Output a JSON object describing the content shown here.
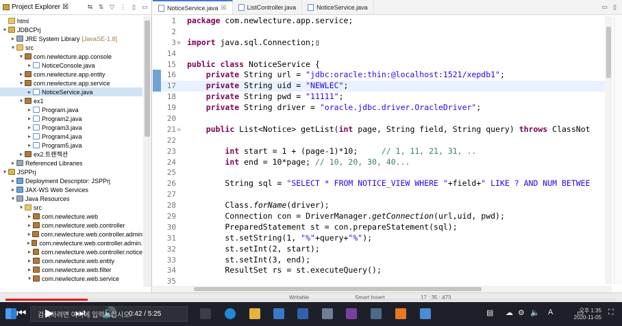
{
  "project_explorer": {
    "title": "Project Explorer",
    "close_glyph": "☒",
    "tools": [
      "⇆",
      "⇅",
      "▽",
      "⋮",
      "▯",
      "▭"
    ],
    "tree": [
      {
        "indent": 0,
        "twisty": "",
        "icon": "folder",
        "label": "html",
        "selected": false
      },
      {
        "indent": 0,
        "twisty": "▾",
        "icon": "project",
        "label": "JDBCPrj",
        "selected": false
      },
      {
        "indent": 1,
        "twisty": "▸",
        "icon": "lib",
        "label": "JRE System Library",
        "suffix": "[JavaSE-1.8]",
        "selected": false
      },
      {
        "indent": 1,
        "twisty": "▾",
        "icon": "folder",
        "label": "src",
        "selected": false
      },
      {
        "indent": 2,
        "twisty": "▾",
        "icon": "package",
        "label": "com.newlecture.app.console",
        "selected": false
      },
      {
        "indent": 3,
        "twisty": "▸",
        "icon": "java",
        "label": "NoticeConsole.java",
        "selected": false
      },
      {
        "indent": 2,
        "twisty": "▸",
        "icon": "package",
        "label": "com.newlecture.app.entity",
        "selected": false
      },
      {
        "indent": 2,
        "twisty": "▾",
        "icon": "package",
        "label": "com.newlecture.app.service",
        "selected": false
      },
      {
        "indent": 3,
        "twisty": "▸",
        "icon": "java",
        "label": "NoticeService.java",
        "selected": true
      },
      {
        "indent": 2,
        "twisty": "▾",
        "icon": "package",
        "label": "ex1",
        "selected": false
      },
      {
        "indent": 3,
        "twisty": "▸",
        "icon": "java",
        "label": "Program.java",
        "selected": false
      },
      {
        "indent": 3,
        "twisty": "▸",
        "icon": "java",
        "label": "Program2.java",
        "selected": false
      },
      {
        "indent": 3,
        "twisty": "▸",
        "icon": "java",
        "label": "Program3.java",
        "selected": false
      },
      {
        "indent": 3,
        "twisty": "▸",
        "icon": "java",
        "label": "Program4.java",
        "selected": false
      },
      {
        "indent": 3,
        "twisty": "▸",
        "icon": "java",
        "label": "Program5.java",
        "selected": false
      },
      {
        "indent": 2,
        "twisty": "▸",
        "icon": "package",
        "label": "ex2.트랜젝션",
        "selected": false
      },
      {
        "indent": 1,
        "twisty": "▸",
        "icon": "lib",
        "label": "Referenced Libraries",
        "selected": false
      },
      {
        "indent": 0,
        "twisty": "▾",
        "icon": "project",
        "label": "JSPPrj",
        "selected": false
      },
      {
        "indent": 1,
        "twisty": "▸",
        "icon": "web",
        "label": "Deployment Descriptor: JSPPrj",
        "selected": false
      },
      {
        "indent": 1,
        "twisty": "▸",
        "icon": "web",
        "label": "JAX-WS Web Services",
        "selected": false
      },
      {
        "indent": 1,
        "twisty": "▾",
        "icon": "lib",
        "label": "Java Resources",
        "selected": false
      },
      {
        "indent": 2,
        "twisty": "▾",
        "icon": "folder",
        "label": "src",
        "selected": false
      },
      {
        "indent": 3,
        "twisty": "▸",
        "icon": "package",
        "label": "com.newlecture.web",
        "selected": false
      },
      {
        "indent": 3,
        "twisty": "▸",
        "icon": "package",
        "label": "com.newlecture.web.controller",
        "selected": false
      },
      {
        "indent": 3,
        "twisty": "▸",
        "icon": "package",
        "label": "com.newlecture.web.controller.admin",
        "selected": false
      },
      {
        "indent": 3,
        "twisty": "▸",
        "icon": "package",
        "label": "com.newlecture.web.controller.admin.",
        "selected": false
      },
      {
        "indent": 3,
        "twisty": "▸",
        "icon": "package",
        "label": "com.newlecture.web.controller.notice",
        "selected": false
      },
      {
        "indent": 3,
        "twisty": "▸",
        "icon": "package",
        "label": "com.newlecture.web.entity",
        "selected": false
      },
      {
        "indent": 3,
        "twisty": "▸",
        "icon": "package",
        "label": "com.newlecture.web.filter",
        "selected": false
      },
      {
        "indent": 3,
        "twisty": "▾",
        "icon": "package",
        "label": "com.newlecture.web.service",
        "selected": false
      }
    ]
  },
  "editor": {
    "tabs": [
      {
        "label": "NoticeService.java",
        "close": "☒",
        "active": true
      },
      {
        "label": "ListController.java",
        "close": "",
        "active": false
      },
      {
        "label": "NoticeService.java",
        "close": "",
        "active": false
      }
    ],
    "tab_controls": [
      "▭",
      "▯"
    ],
    "lines": [
      {
        "no": "1",
        "fold": "",
        "current": false,
        "marker": false,
        "tokens": [
          [
            "kw",
            "package"
          ],
          [
            "",
            "com.newlecture.app.service;"
          ]
        ]
      },
      {
        "no": "2",
        "fold": "",
        "current": false,
        "marker": false,
        "tokens": []
      },
      {
        "no": "3",
        "fold": "⊕",
        "current": false,
        "marker": false,
        "tokens": [
          [
            "kw",
            "import"
          ],
          [
            "",
            "java.sql.Connection;"
          ],
          [
            "",
            "▯"
          ]
        ]
      },
      {
        "no": "14",
        "fold": "",
        "current": false,
        "marker": false,
        "tokens": []
      },
      {
        "no": "15",
        "fold": "",
        "current": false,
        "marker": false,
        "tokens": [
          [
            "kw",
            "public class"
          ],
          [
            "",
            " NoticeService {"
          ]
        ]
      },
      {
        "no": "16",
        "fold": "",
        "current": false,
        "marker": true,
        "tokens": [
          [
            "",
            "    "
          ],
          [
            "kw",
            "private"
          ],
          [
            "",
            " String url = "
          ],
          [
            "str",
            "\"jdbc:oracle:thin:@localhost:1521/xepdb1\""
          ],
          [
            "",
            ";"
          ]
        ]
      },
      {
        "no": "17",
        "fold": "",
        "current": true,
        "marker": true,
        "tokens": [
          [
            "",
            "    "
          ],
          [
            "kw",
            "private"
          ],
          [
            "",
            " String uid = "
          ],
          [
            "str",
            "\"NEWLEC\""
          ],
          [
            "",
            ";"
          ]
        ]
      },
      {
        "no": "18",
        "fold": "",
        "current": false,
        "marker": false,
        "tokens": [
          [
            "",
            "    "
          ],
          [
            "kw",
            "private"
          ],
          [
            "",
            " String pwd = "
          ],
          [
            "str",
            "\"11111\""
          ],
          [
            "",
            ";"
          ]
        ]
      },
      {
        "no": "19",
        "fold": "",
        "current": false,
        "marker": false,
        "tokens": [
          [
            "",
            "    "
          ],
          [
            "kw",
            "private"
          ],
          [
            "",
            " String driver = "
          ],
          [
            "str",
            "\"oracle.jdbc.driver.OracleDriver\""
          ],
          [
            "",
            ";"
          ]
        ]
      },
      {
        "no": "20",
        "fold": "",
        "current": false,
        "marker": false,
        "tokens": []
      },
      {
        "no": "21",
        "fold": "⊖",
        "current": false,
        "marker": false,
        "tokens": [
          [
            "",
            "    "
          ],
          [
            "kw",
            "public"
          ],
          [
            "",
            " List<Notice> getList("
          ],
          [
            "kw",
            "int"
          ],
          [
            "",
            " page, String field, String query) "
          ],
          [
            "kw",
            "throws"
          ],
          [
            "",
            " ClassNot"
          ]
        ]
      },
      {
        "no": "22",
        "fold": "",
        "current": false,
        "marker": false,
        "tokens": []
      },
      {
        "no": "23",
        "fold": "",
        "current": false,
        "marker": false,
        "tokens": [
          [
            "",
            "        "
          ],
          [
            "kw",
            "int"
          ],
          [
            "",
            " start = 1 + (page-1)*10;     "
          ],
          [
            "cmt",
            "// 1, 11, 21, 31, .."
          ]
        ]
      },
      {
        "no": "24",
        "fold": "",
        "current": false,
        "marker": false,
        "tokens": [
          [
            "",
            "        "
          ],
          [
            "kw",
            "int"
          ],
          [
            "",
            " end = 10*page; "
          ],
          [
            "cmt",
            "// 10, 20, 30, 40..."
          ]
        ]
      },
      {
        "no": "25",
        "fold": "",
        "current": false,
        "marker": false,
        "tokens": []
      },
      {
        "no": "26",
        "fold": "",
        "current": false,
        "marker": false,
        "tokens": [
          [
            "",
            "        String sql = "
          ],
          [
            "str",
            "\"SELECT * FROM NOTICE_VIEW WHERE \""
          ],
          [
            "",
            "+field+"
          ],
          [
            "str",
            "\" LIKE ? AND NUM BETWEE"
          ]
        ]
      },
      {
        "no": "27",
        "fold": "",
        "current": false,
        "marker": false,
        "tokens": []
      },
      {
        "no": "28",
        "fold": "",
        "current": false,
        "marker": false,
        "tokens": [
          [
            "",
            "        Class."
          ],
          [
            "it",
            "forName"
          ],
          [
            "",
            "(driver);"
          ]
        ]
      },
      {
        "no": "29",
        "fold": "",
        "current": false,
        "marker": false,
        "tokens": [
          [
            "",
            "        Connection con = DriverManager."
          ],
          [
            "it",
            "getConnection"
          ],
          [
            "",
            "(url,uid, pwd);"
          ]
        ]
      },
      {
        "no": "30",
        "fold": "",
        "current": false,
        "marker": false,
        "tokens": [
          [
            "",
            "        PreparedStatement st = con.prepareStatement(sql);"
          ]
        ]
      },
      {
        "no": "31",
        "fold": "",
        "current": false,
        "marker": false,
        "tokens": [
          [
            "",
            "        st.setString(1, "
          ],
          [
            "str",
            "\"%\""
          ],
          [
            "",
            "+query+"
          ],
          [
            "str",
            "\"%\""
          ],
          [
            "",
            ");"
          ]
        ]
      },
      {
        "no": "32",
        "fold": "",
        "current": false,
        "marker": false,
        "tokens": [
          [
            "",
            "        st.setInt(2, start);"
          ]
        ]
      },
      {
        "no": "33",
        "fold": "",
        "current": false,
        "marker": false,
        "tokens": [
          [
            "",
            "        st.setInt(3, end);"
          ]
        ]
      },
      {
        "no": "34",
        "fold": "",
        "current": false,
        "marker": false,
        "tokens": [
          [
            "",
            "        ResultSet rs = st.executeQuery();"
          ]
        ]
      },
      {
        "no": "35",
        "fold": "",
        "current": false,
        "marker": false,
        "tokens": []
      }
    ]
  },
  "status": {
    "writable": "Writable",
    "insert_mode": "Smart Insert",
    "position": "17 : 35 : 473"
  },
  "video": {
    "progress": 0.134,
    "time": "0:42 / 5:25",
    "accent": "#ff0000"
  },
  "taskbar": {
    "search_text": "검색하려면 여기에 입력하십시오.",
    "lang": "A",
    "time": "오후 1:35",
    "date": "2020-11-05"
  }
}
